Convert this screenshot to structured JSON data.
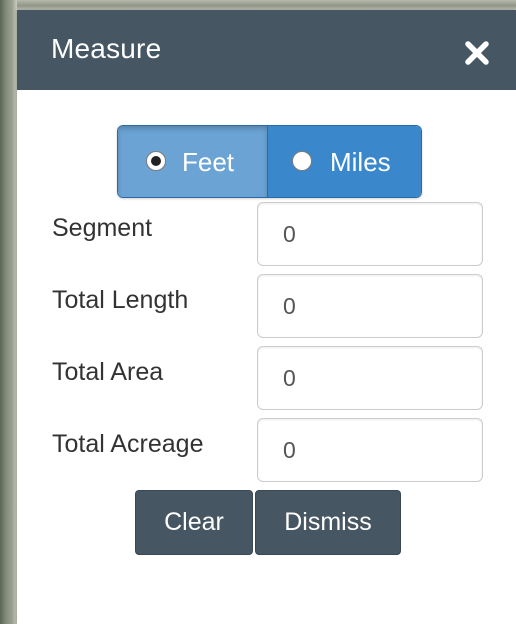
{
  "panel": {
    "title": "Measure",
    "close_icon": "close-icon"
  },
  "units": {
    "selected": "Feet",
    "options": [
      {
        "label": "Feet",
        "checked": true
      },
      {
        "label": "Miles",
        "checked": false
      }
    ]
  },
  "fields": [
    {
      "label": "Segment",
      "value": "0"
    },
    {
      "label": "Total Length",
      "value": "0"
    },
    {
      "label": "Total Area",
      "value": "0"
    },
    {
      "label": "Total Acreage",
      "value": "0"
    }
  ],
  "actions": {
    "clear_label": "Clear",
    "dismiss_label": "Dismiss"
  },
  "colors": {
    "header": "#465663",
    "toggle_active": "#6aa3d4",
    "toggle_inactive": "#3b87cc",
    "button": "#465663"
  }
}
